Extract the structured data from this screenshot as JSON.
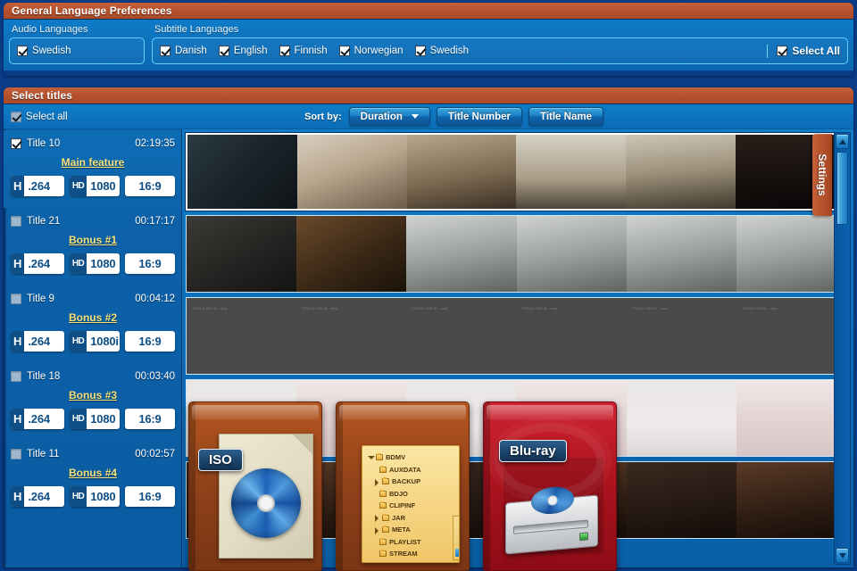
{
  "lang_panel": {
    "title": "General Language Preferences",
    "audio_label": "Audio Languages",
    "subtitle_label": "Subtitle Languages",
    "audio_languages": [
      {
        "label": "Swedish",
        "checked": true
      }
    ],
    "subtitle_languages": [
      {
        "label": "Danish",
        "checked": true
      },
      {
        "label": "English",
        "checked": true
      },
      {
        "label": "Finnish",
        "checked": true
      },
      {
        "label": "Norwegian",
        "checked": true
      },
      {
        "label": "Swedish",
        "checked": true
      }
    ],
    "select_all_label": "Select All"
  },
  "titles_panel": {
    "title": "Select titles",
    "select_all_label": "Select all",
    "sort_by_label": "Sort by:",
    "sort_buttons": [
      {
        "label": "Duration",
        "active": true,
        "has_caret": true
      },
      {
        "label": "Title Number",
        "active": false,
        "has_caret": false
      },
      {
        "label": "Title Name",
        "active": false,
        "has_caret": false
      }
    ],
    "titles": [
      {
        "name": "Title 10",
        "duration": "02:19:35",
        "subtitle": "Main feature",
        "checked": true,
        "selected": true,
        "codec_prefix": "H",
        "codec": ".264",
        "res_prefix": "HD",
        "res": "1080",
        "aspect": "16:9"
      },
      {
        "name": "Title 21",
        "duration": "00:17:17",
        "subtitle": "Bonus #1",
        "checked": false,
        "selected": false,
        "codec_prefix": "H",
        "codec": ".264",
        "res_prefix": "HD",
        "res": "1080",
        "aspect": "16:9"
      },
      {
        "name": "Title 9",
        "duration": "00:04:12",
        "subtitle": "Bonus #2",
        "checked": false,
        "selected": false,
        "codec_prefix": "H",
        "codec": ".264",
        "res_prefix": "HD",
        "res": "1080i",
        "aspect": "16:9"
      },
      {
        "name": "Title 18",
        "duration": "00:03:40",
        "subtitle": "Bonus #3",
        "checked": false,
        "selected": false,
        "codec_prefix": "H",
        "codec": ".264",
        "res_prefix": "HD",
        "res": "1080",
        "aspect": "16:9"
      },
      {
        "name": "Title 11",
        "duration": "00:02:57",
        "subtitle": "Bonus #4",
        "checked": false,
        "selected": false,
        "codec_prefix": "H",
        "codec": ".264",
        "res_prefix": "HD",
        "res": "1080",
        "aspect": "16:9"
      }
    ],
    "thumbnail_faint_label": "TRACK 005 M - way"
  },
  "settings_tab": {
    "label": "Settings"
  },
  "scrollbar": {
    "up_icon": "triangle-up-icon",
    "down_icon": "triangle-down-icon"
  },
  "cards": {
    "iso": {
      "tag": "ISO",
      "icon": "disc-icon"
    },
    "bdmv": {
      "tree": [
        {
          "label": "BDMV",
          "level": 0,
          "twisty": "expanded"
        },
        {
          "label": "AUXDATA",
          "level": 1,
          "twisty": "none"
        },
        {
          "label": "BACKUP",
          "level": 1,
          "twisty": "collapsed"
        },
        {
          "label": "BDJO",
          "level": 1,
          "twisty": "none"
        },
        {
          "label": "CLIPINF",
          "level": 1,
          "twisty": "none"
        },
        {
          "label": "JAR",
          "level": 1,
          "twisty": "collapsed"
        },
        {
          "label": "META",
          "level": 1,
          "twisty": "collapsed"
        },
        {
          "label": "PLAYLIST",
          "level": 1,
          "twisty": "none"
        },
        {
          "label": "STREAM",
          "level": 1,
          "twisty": "none"
        }
      ]
    },
    "bluray": {
      "tag": "Blu-ray",
      "icon": "optical-drive-icon"
    }
  },
  "colors": {
    "header_orange": "#b4512c",
    "panel_blue": "#0d72bd",
    "list_blue": "#0b5ca2",
    "accent_yellow": "#f6e27a",
    "badge_dark": "#0d4f86",
    "card_orange": "#8d4019",
    "card_red": "#a6121d"
  }
}
